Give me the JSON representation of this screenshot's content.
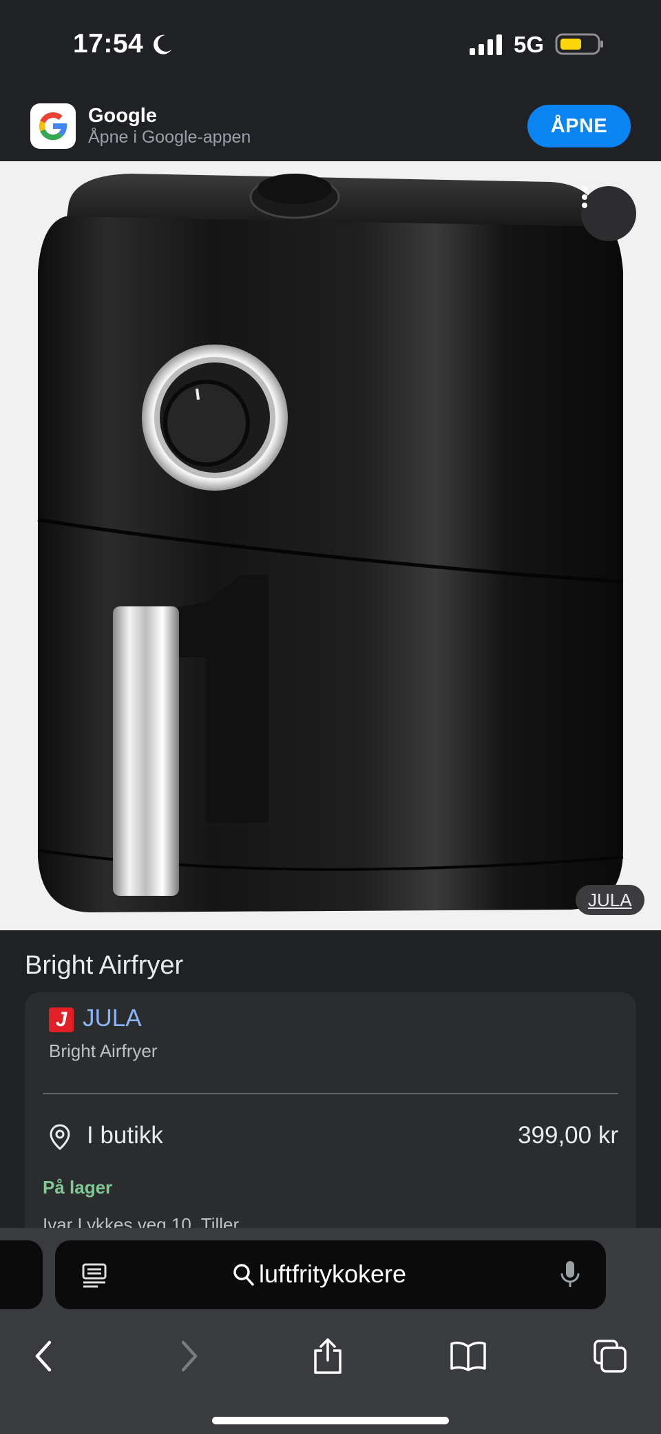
{
  "status_bar": {
    "time": "17:54",
    "network": "5G",
    "battery_color": "#ffd60a",
    "icons": [
      "moon-icon",
      "cellular-signal-icon",
      "battery-icon"
    ]
  },
  "google_banner": {
    "title": "Google",
    "subtitle": "Åpne i Google-appen",
    "open_label": "ÅPNE",
    "accent": "#0b84f3"
  },
  "product_image": {
    "badge": "JULA"
  },
  "product": {
    "title": "Bright Airfryer",
    "offer": {
      "store_logo_letter": "J",
      "store_name": "JULA",
      "subtitle": "Bright Airfryer",
      "availability": "I butikk",
      "price": "399,00 kr",
      "stock": "På lager",
      "address": "Ivar Lykkes veg 10, Tiller"
    }
  },
  "browser": {
    "address": "luftfritykokere",
    "icons": [
      "reader-icon",
      "search-icon",
      "mic-icon",
      "back-icon",
      "forward-icon",
      "share-icon",
      "bookmarks-icon",
      "tabs-icon"
    ]
  },
  "colors": {
    "background": "#202124",
    "link": "#8ab4f8",
    "in_stock": "#81c995",
    "jula_red": "#e31f26"
  }
}
